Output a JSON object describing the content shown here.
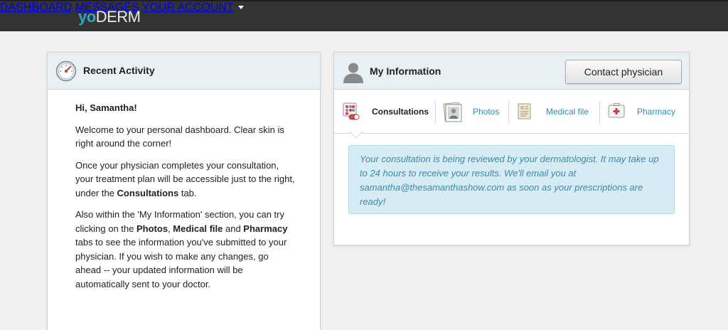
{
  "header": {
    "logo_part1": "yo",
    "logo_part2": "DERM",
    "nav": {
      "dashboard": "DASHBOARD",
      "messages": "MESSAGES",
      "account": "YOUR ACCOUNT"
    }
  },
  "recent_activity": {
    "title": "Recent Activity",
    "greeting": "Hi, Samantha!",
    "p1": "Welcome to your personal dashboard. Clear skin is right around the corner!",
    "p2_a": "Once your physician completes your consultation, your treatment plan will be accessible just to the right, under the ",
    "p2_b": "Consultations",
    "p2_c": " tab.",
    "p3_a": "Also within the 'My Information' section, you can try clicking on the ",
    "p3_b": "Photos",
    "p3_c": ", ",
    "p3_d": "Medical file",
    "p3_e": " and ",
    "p3_f": "Pharmacy",
    "p3_g": " tabs to see the information you've submitted to your physician. If you wish to make any changes, go ahead -- your updated information will be automatically sent to your doctor."
  },
  "my_information": {
    "title": "My Information",
    "contact_button": "Contact physician",
    "tabs": [
      {
        "label": "Consultations"
      },
      {
        "label": "Photos"
      },
      {
        "label": "Medical file"
      },
      {
        "label": "Pharmacy"
      }
    ],
    "notice": "Your consultation is being reviewed by your dermatologist. It may take up to 24 hours to receive your results. We'll email you at samantha@thesamanthashow.com as soon as your prescriptions are ready!"
  },
  "colors": {
    "topbar": "#333333",
    "logo_accent": "#2aa9c7",
    "link": "#2a8fb4",
    "notice_bg": "#d6ecf5",
    "notice_text": "#3a8aab",
    "panel_header": "#e8f0f4"
  },
  "icons": {
    "recent_activity": "gauge-icon",
    "my_information": "user-silhouette-icon",
    "consultations": "pill-pack-icon",
    "photos": "photo-portrait-icon",
    "medical_file": "document-icon",
    "pharmacy": "first-aid-kit-icon",
    "account_dropdown": "caret-down-icon"
  }
}
